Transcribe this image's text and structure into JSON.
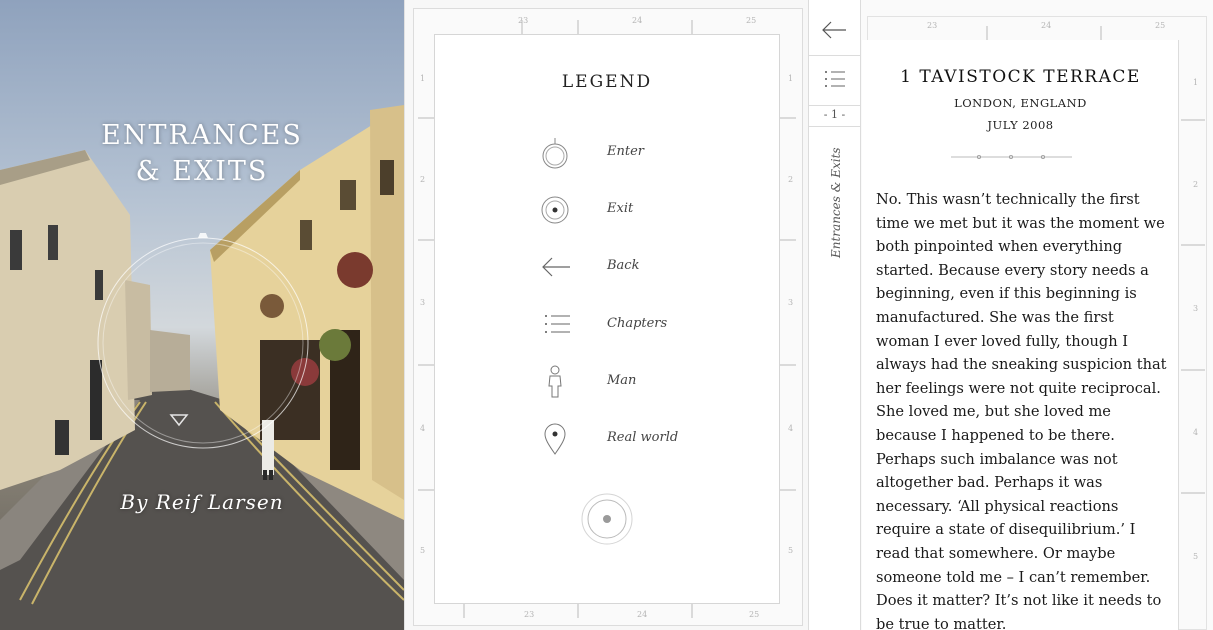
{
  "cover": {
    "title_line1": "ENTRANCES",
    "title_line2": "& EXITS",
    "author": "By Reif Larsen"
  },
  "ruler": {
    "top_numbers": [
      "23",
      "24",
      "25"
    ],
    "side_numbers": [
      "1",
      "2",
      "3",
      "4",
      "5"
    ]
  },
  "legend": {
    "title": "LEGEND",
    "items": [
      {
        "icon": "enter-icon",
        "label": "Enter"
      },
      {
        "icon": "exit-icon",
        "label": "Exit"
      },
      {
        "icon": "back-arrow-icon",
        "label": "Back"
      },
      {
        "icon": "chapters-list-icon",
        "label": "Chapters"
      },
      {
        "icon": "man-icon",
        "label": "Man"
      },
      {
        "icon": "map-pin-icon",
        "label": "Real world"
      }
    ]
  },
  "rail": {
    "back_icon": "back-arrow-icon",
    "chapters_icon": "chapters-list-icon",
    "page_indicator": "- 1 -",
    "book_title": "Entrances & Exits"
  },
  "chapter": {
    "title": "1 TAVISTOCK TERRACE",
    "location": "LONDON, ENGLAND",
    "date": "JULY 2008",
    "lines": [
      "No. This wasn’t technically the first",
      "time we met but it was the moment we",
      "both pinpointed when everything",
      "started. Because every story needs a",
      "beginning, even if this beginning is",
      "manufactured. She was the first",
      "woman I ever loved fully, though I",
      "always had the sneaking suspicion that",
      "her feelings were not quite reciprocal.",
      "She loved me, but she loved me",
      "because I happened to be there.",
      "Perhaps such imbalance was not",
      "altogether bad. Perhaps it was",
      "necessary. ‘All physical reactions",
      "require a state of disequilibrium.’ I",
      "read that somewhere. Or maybe",
      "someone told me – I can’t remember.",
      "Does it matter? It’s not like it needs to",
      "be true to matter."
    ]
  }
}
